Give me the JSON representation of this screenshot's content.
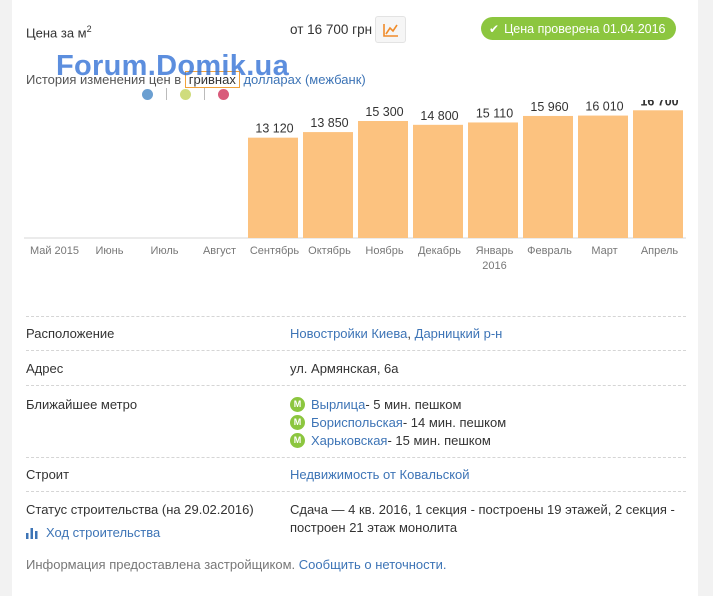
{
  "header": {
    "price_label": "Цена за м",
    "price_label_sup": "2",
    "price_value": "от 16 700 грн",
    "chart_button_icon": "chart-icon",
    "verified_badge": "Цена проверена 01.04.2016",
    "badge_color": "#8cc63f"
  },
  "watermark": "Forum.Domik.ua",
  "history": {
    "label": "История изменения цен в",
    "current": "гривнах",
    "alt": "долларах (межбанк)",
    "dot_colors": [
      "#6b9fd1",
      "#cfdc7d",
      "#d95b7b"
    ]
  },
  "chart_data": {
    "type": "bar",
    "categories": [
      "Май 2015",
      "Июнь",
      "Июль",
      "Август",
      "Сентябрь",
      "Октябрь",
      "Ноябрь",
      "Декабрь",
      "Январь\n2016",
      "Февраль",
      "Март",
      "Апрель"
    ],
    "values": [
      null,
      null,
      null,
      null,
      13120,
      13850,
      15300,
      14800,
      15110,
      15960,
      16010,
      16700
    ],
    "value_labels": [
      "",
      "",
      "",
      "",
      "13 120",
      "13 850",
      "15 300",
      "14 800",
      "15 110",
      "15 960",
      "16 010",
      "16 700"
    ],
    "highlight_index": 11,
    "bar_color": "#fcc27f",
    "ylim": [
      0,
      17000
    ]
  },
  "details": {
    "location_label": "Расположение",
    "location_link1": "Новостройки Киева",
    "location_sep": ", ",
    "location_link2": "Дарницкий р-н",
    "address_label": "Адрес",
    "address_value": "ул. Армянская, 6а",
    "metro_label": "Ближайшее метро",
    "metro": [
      {
        "name": "Вырлица",
        "time": " - 5 мин. пешком"
      },
      {
        "name": "Бориспольская",
        "time": " - 14 мин. пешком"
      },
      {
        "name": "Харьковская",
        "time": " - 15 мин. пешком"
      }
    ],
    "metro_icon_letter": "M",
    "builder_label": "Строит",
    "builder_value": "Недвижимость от Ковальской",
    "status_label": "Статус строительства (на 29.02.2016)",
    "status_value": "Сдача — 4 кв. 2016, 1 секция - построены 19 этажей, 2 секция - построен 21 этаж монолита",
    "progress_link": "Ход строительства",
    "progress_icon": "bar-chart-icon"
  },
  "footer": {
    "info": "Информация предоставлена застройщиком.",
    "report_link": "Сообщить о неточности."
  }
}
